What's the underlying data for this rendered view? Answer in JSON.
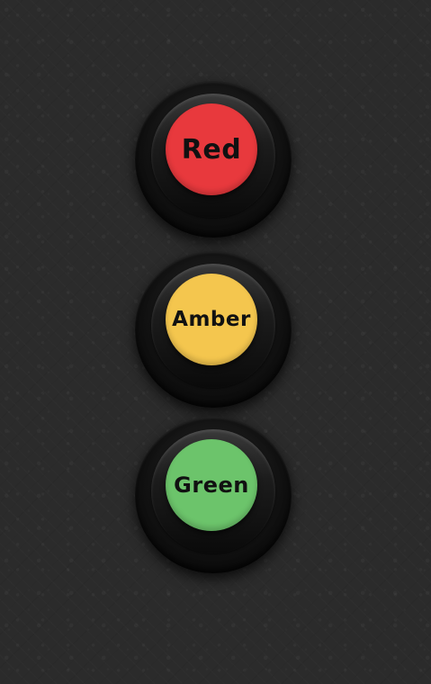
{
  "lights": [
    {
      "id": "red",
      "label": "Red",
      "color": "#e8393d"
    },
    {
      "id": "amber",
      "label": "Amber",
      "color": "#f4c64e"
    },
    {
      "id": "green",
      "label": "Green",
      "color": "#6cc46b"
    }
  ],
  "background": {
    "color": "#2b2b2b"
  },
  "housing": {
    "color": "#111111"
  }
}
